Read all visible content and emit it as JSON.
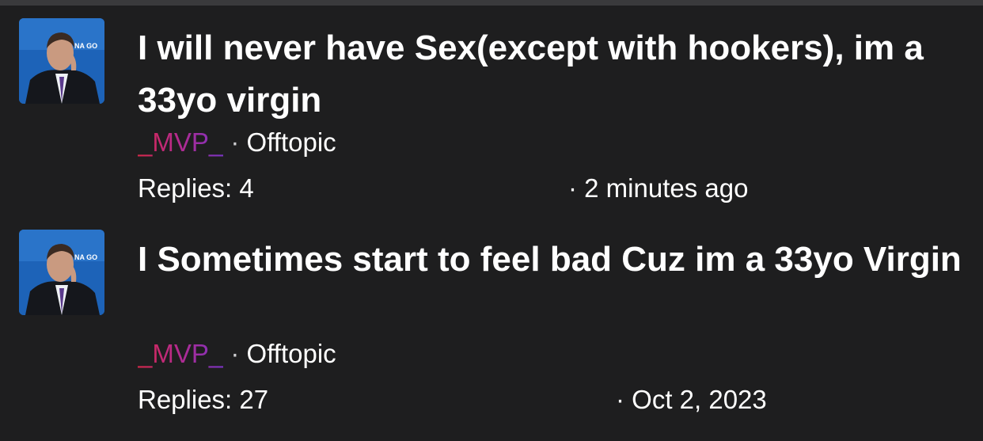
{
  "threads": [
    {
      "title": "I will never have Sex(except with hookers), im a 33yo virgin",
      "author": "_MVP_",
      "separator": " · ",
      "category": "Offtopic",
      "replies_label": "Replies: 4",
      "time_label": "· 2 minutes ago",
      "avatar_icon": "user-avatar-photo"
    },
    {
      "title": "I Sometimes start to feel bad Cuz im a 33yo Virgin",
      "author": "_MVP_",
      "separator": " · ",
      "category": "Offtopic",
      "replies_label": "Replies: 27",
      "time_label": "· Oct 2, 2023",
      "avatar_icon": "user-avatar-photo"
    }
  ],
  "colors": {
    "background": "#1e1e1f",
    "text": "#ffffff",
    "username_gradient_start": "#d6284a",
    "username_gradient_end": "#7b34c4"
  }
}
